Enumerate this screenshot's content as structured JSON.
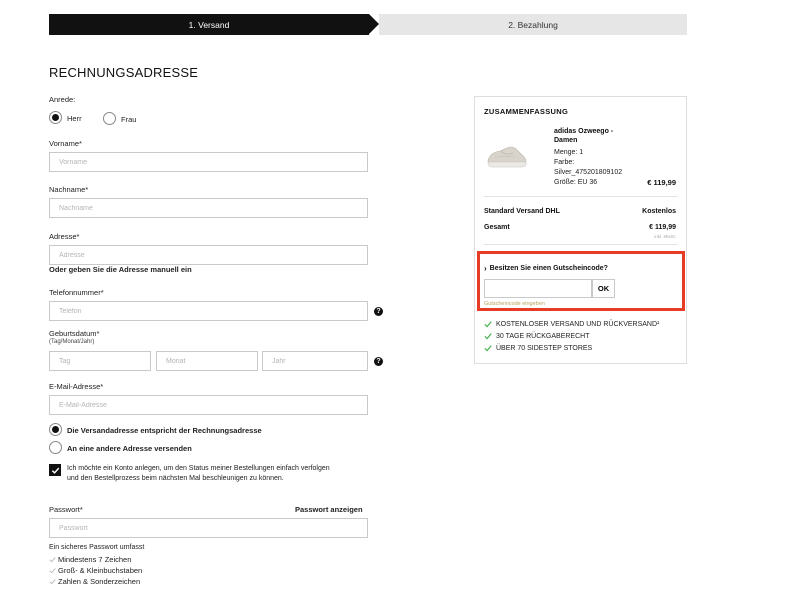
{
  "stepper": {
    "step1": "1. Versand",
    "step2": "2. Bezahlung"
  },
  "form": {
    "title": "RECHNUNGSADRESSE",
    "salutation_label": "Anrede:",
    "salutation_options": [
      {
        "label": "Herr",
        "selected": true
      },
      {
        "label": "Frau",
        "selected": false
      }
    ],
    "firstname": {
      "label": "Vorname*",
      "placeholder": "Vorname",
      "value": ""
    },
    "lastname": {
      "label": "Nachname*",
      "placeholder": "Nachname",
      "value": ""
    },
    "address": {
      "label": "Adresse*",
      "placeholder": "Adresse",
      "value": "",
      "manual_link": "Oder geben Sie die Adresse manuell ein"
    },
    "phone": {
      "label": "Telefonnummer*",
      "placeholder": "Telefon",
      "value": ""
    },
    "birthdate": {
      "label": "Geburtsdatum*",
      "sublabel": "(Tag/Monat/Jahr)",
      "day_placeholder": "Tag",
      "month_placeholder": "Monat",
      "year_placeholder": "Jahr"
    },
    "email": {
      "label": "E-Mail-Adresse*",
      "placeholder": "E-Mail-Adresse",
      "value": ""
    },
    "shipping_options": [
      {
        "label": "Die Versandadresse entspricht der Rechnungsadresse",
        "selected": true
      },
      {
        "label": "An eine andere Adresse versenden",
        "selected": false
      }
    ],
    "account_checkbox": {
      "checked": true,
      "text_line1": "Ich möchte ein Konto anlegen, um den Status meiner Bestellungen einfach verfolgen",
      "text_line2": "und den Bestellprozess beim nächsten Mal beschleunigen zu können."
    },
    "password": {
      "label": "Passwort*",
      "show_label": "Passwort anzeigen",
      "placeholder": "Passwort",
      "requirements_title": "Ein sicheres Passwort umfasst",
      "requirements": [
        "Mindestens 7 Zeichen",
        "Groß- & Kleinbuchstaben",
        "Zahlen & Sonderzeichen"
      ]
    }
  },
  "summary": {
    "title": "ZUSAMMENFASSUNG",
    "product": {
      "name_line1": "adidas Ozweego -",
      "name_line2": "Damen",
      "quantity": "Menge: 1",
      "color_label": "Farbe:",
      "color_value": "Silver_475201809102",
      "size": "Größe: EU 36",
      "price": "€ 119,99"
    },
    "shipping_label": "Standard Versand DHL",
    "shipping_value": "Kostenlos",
    "total_label": "Gesamt",
    "total_value": "€ 119,99",
    "total_note": "inkl. MwSt.",
    "voucher_question": "Besitzen Sie einen Gutscheincode?",
    "voucher_button": "OK",
    "voucher_hint": "Gutscheincode eingeben",
    "usps": [
      "KOSTENLOSER VERSAND UND RÜCKVERSAND¹",
      "30 TAGE RÜCKGABERECHT",
      "ÜBER 70 SIDESTEP STORES"
    ]
  },
  "colors": {
    "accent_check": "#3fae49",
    "highlight": "#e63b24",
    "dark": "#111111"
  }
}
